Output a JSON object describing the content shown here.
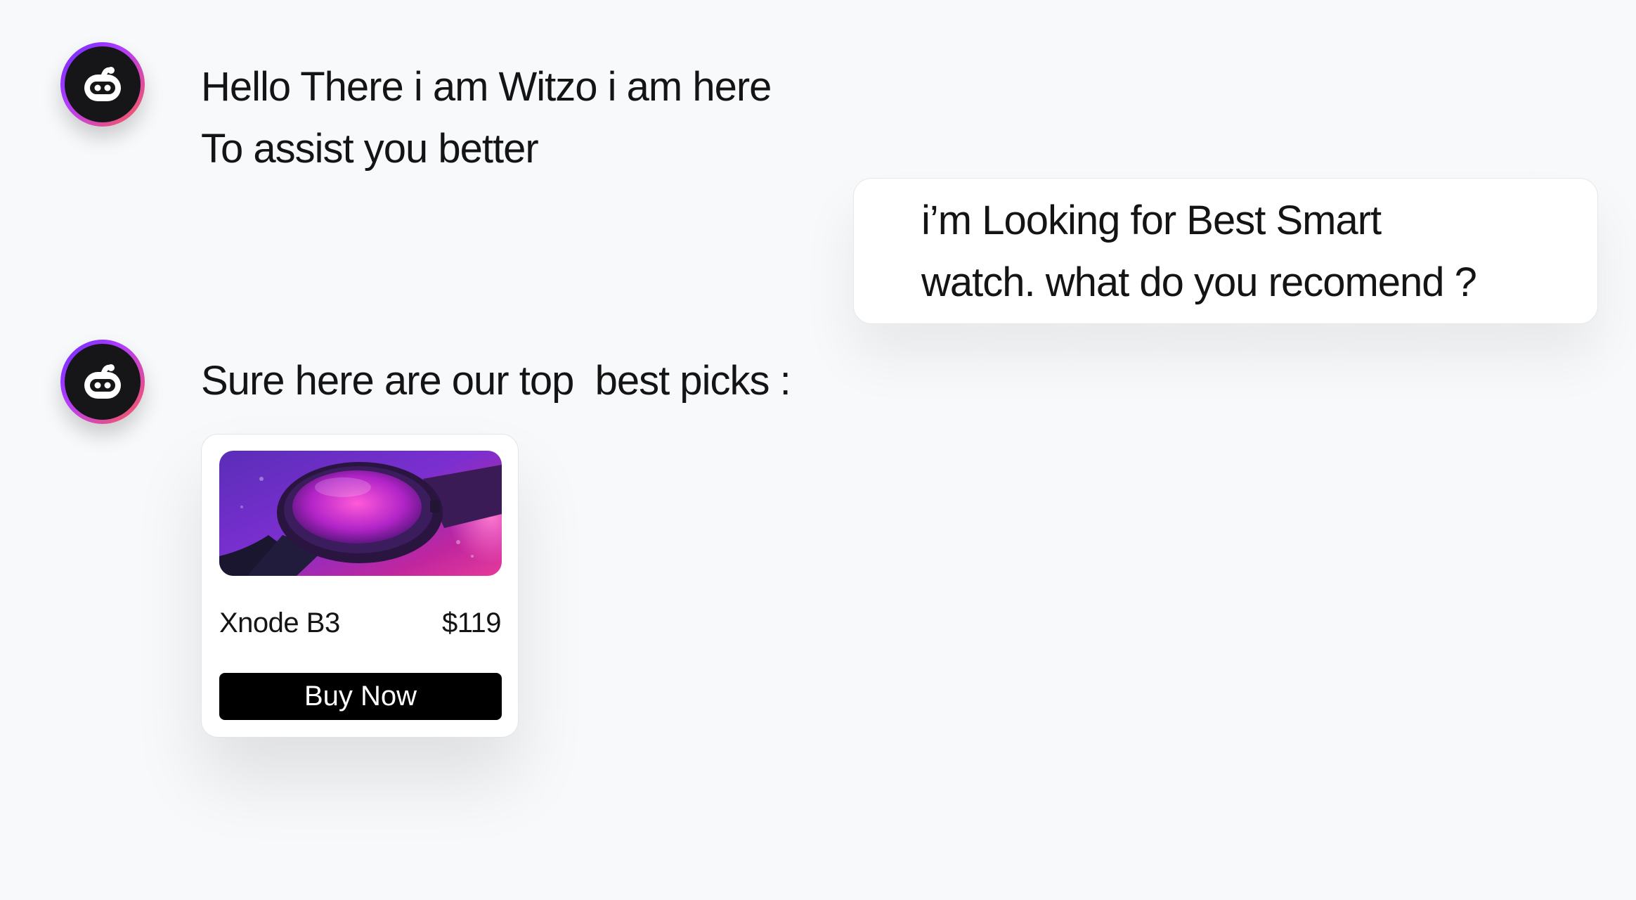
{
  "assistant": {
    "name": "Witzo",
    "avatar_icon": "robot-face-icon"
  },
  "messages": {
    "greeting": {
      "line1": "Hello There i am Witzo i am here",
      "line2": "To assist you better"
    },
    "user_query": {
      "line1": "i’m Looking for Best Smart",
      "line2": "watch. what do you recomend ?"
    },
    "reply": {
      "text": "Sure here are our top  best picks :"
    }
  },
  "product": {
    "name": "Xnode B3",
    "price": "$119",
    "buy_label": "Buy Now",
    "image_icon": "smartwatch-image"
  },
  "colors": {
    "background": "#f8f9fb",
    "avatar_ring_start": "#6a2cff",
    "avatar_ring_end": "#ff5a4f",
    "avatar_fill": "#161618",
    "button_bg": "#000000",
    "button_text": "#ffffff"
  }
}
